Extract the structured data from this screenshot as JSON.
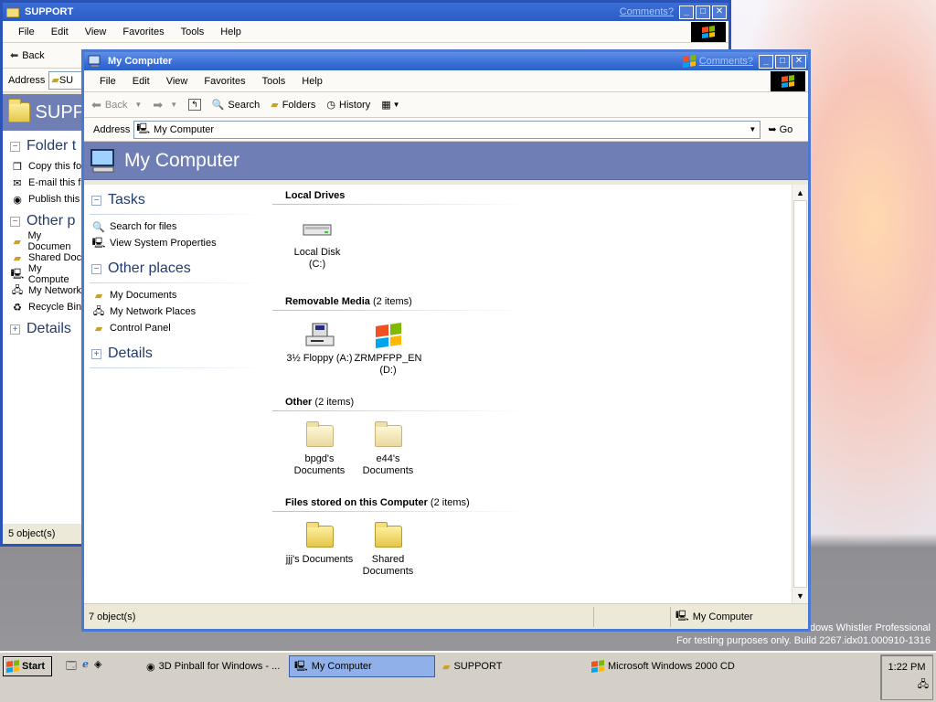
{
  "colors": {
    "titlebar_active": "#3a6fd8",
    "header_band": "#6f7fb5",
    "link_heading": "#243c6b",
    "taskbar": "#d4d0c8"
  },
  "desktop": {
    "watermark_line1": "ndows Whistler Professional",
    "watermark_line2": "For testing purposes only. Build 2267.idx01.000910-1316"
  },
  "support_window": {
    "title": "SUPPORT",
    "comments_link": "Comments?",
    "menus": [
      "File",
      "Edit",
      "View",
      "Favorites",
      "Tools",
      "Help"
    ],
    "back_label": "Back",
    "address_label": "Address",
    "address_value": "SU",
    "header_title": "SUPP",
    "folder_tasks_heading": "Folder t",
    "folder_tasks": [
      "Copy this fo",
      "E-mail this fi",
      "Publish this"
    ],
    "other_places_heading": "Other p",
    "other_places": [
      "My Documen",
      "Shared Doc",
      "My Compute",
      "My Network",
      "Recycle Bin"
    ],
    "details_heading": "Details",
    "status": "5 object(s)"
  },
  "mycomputer_window": {
    "title": "My Computer",
    "comments_link": "Comments?",
    "menus": [
      "File",
      "Edit",
      "View",
      "Favorites",
      "Tools",
      "Help"
    ],
    "toolbar": {
      "back": "Back",
      "search": "Search",
      "folders": "Folders",
      "history": "History"
    },
    "address_label": "Address",
    "address_value": "My Computer",
    "go_label": "Go",
    "header_title": "My Computer",
    "tasks_heading": "Tasks",
    "tasks": [
      "Search for files",
      "View System Properties"
    ],
    "other_places_heading": "Other places",
    "other_places": [
      "My Documents",
      "My Network Places",
      "Control Panel"
    ],
    "details_heading": "Details",
    "groups": {
      "local_drives": {
        "title": "Local Drives",
        "count": "",
        "items": [
          "Local Disk (C:)"
        ]
      },
      "removable": {
        "title": "Removable Media",
        "count": "(2 items)",
        "items": [
          "3½ Floppy (A:)",
          "ZRMPFPP_EN (D:)"
        ]
      },
      "other": {
        "title": "Other",
        "count": "(2 items)",
        "items": [
          "bpgd's Documents",
          "e44's Documents"
        ]
      },
      "stored": {
        "title": "Files stored on this Computer",
        "count": "(2 items)",
        "items": [
          "jjj's Documents",
          "Shared Documents"
        ]
      }
    },
    "status_left": "7 object(s)",
    "status_right": "My Computer"
  },
  "taskbar": {
    "start_label": "Start",
    "buttons": [
      "3D Pinball for Windows - ...",
      "My Computer",
      "SUPPORT",
      "Microsoft Windows 2000 CD"
    ],
    "clock": "1:22 PM"
  }
}
